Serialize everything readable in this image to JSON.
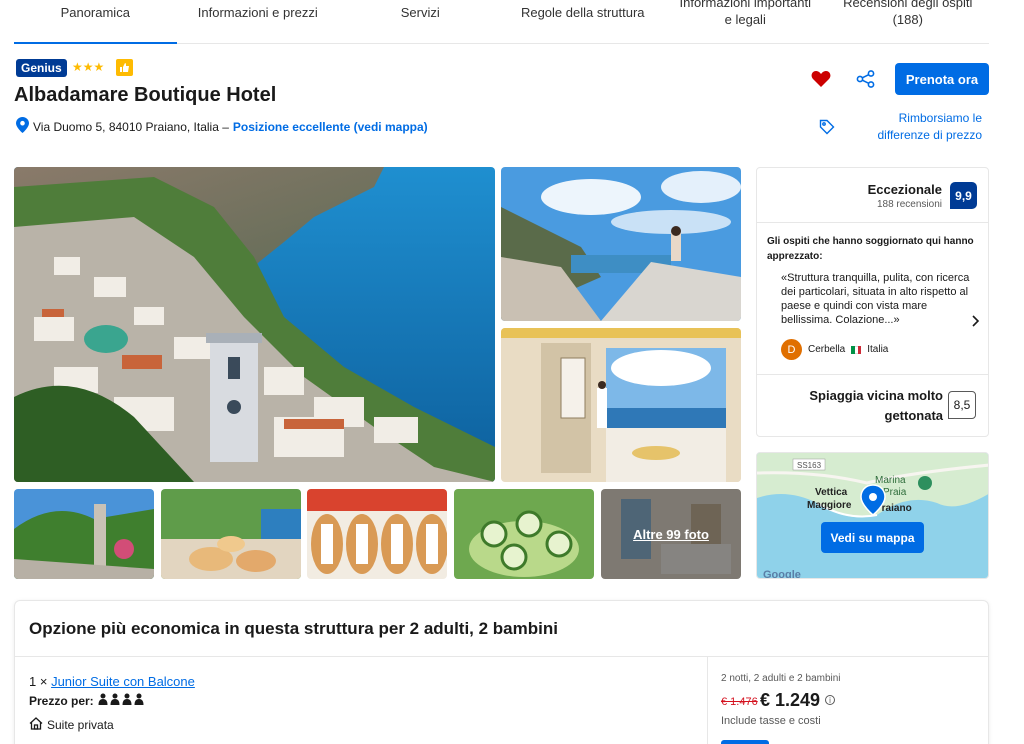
{
  "tabs": [
    "Panoramica",
    "Informazioni e prezzi",
    "Servizi",
    "Regole della struttura",
    "Informazioni importanti e legali",
    "Recensioni degli ospiti (188)"
  ],
  "header": {
    "genius": "Genius",
    "stars": "★★★",
    "name": "Albadamare Boutique Hotel",
    "address": "Via Duomo 5, 84010 Praiano, Italia –",
    "location_link": "Posizione eccellente (vedi mappa)",
    "reserve": "Prenota ora",
    "refund": "Rimborsiamo le differenze di prezzo"
  },
  "photos": {
    "more": "Altre 99 foto"
  },
  "review": {
    "word": "Eccezionale",
    "count": "188 recensioni",
    "score": "9,9",
    "liked": "Gli ospiti che hanno soggiornato qui hanno apprezzato:",
    "quote": "«Struttura tranquilla, pulita, con ricerca dei particolari, situata in alto rispetto al paese e quindi con vista mare bellissima. Colazione...»",
    "reviewer_initial": "D",
    "reviewer_name": "Cerbella",
    "reviewer_country": "Italia",
    "beach": "Spiaggia vicina molto gettonata",
    "beach_score": "8,5"
  },
  "map": {
    "button": "Vedi su mappa",
    "label_road": "SS163",
    "label_marina": "Marina",
    "label_praia": "Praia",
    "label_vettica": "Vettica",
    "label_maggiore": "Maggiore",
    "label_praiano": "Praiano",
    "label_google": "Google"
  },
  "cheapest": {
    "title": "Opzione più economica in questa struttura per 2 adulti, 2 bambini",
    "qty": "1 ×",
    "room": "Junior Suite con Balcone",
    "price_for": "Prezzo per:",
    "private": "Suite privata",
    "nights": "2 notti, 2 adulti e 2 bambini",
    "old_price": "€ 1.476",
    "new_price": "€ 1.249",
    "taxes": "Include tasse e costi"
  },
  "colors": {
    "brand_blue": "#006ce4",
    "dark_blue": "#003b95",
    "star_yellow": "#febb02",
    "heart_red": "#cc0000"
  }
}
